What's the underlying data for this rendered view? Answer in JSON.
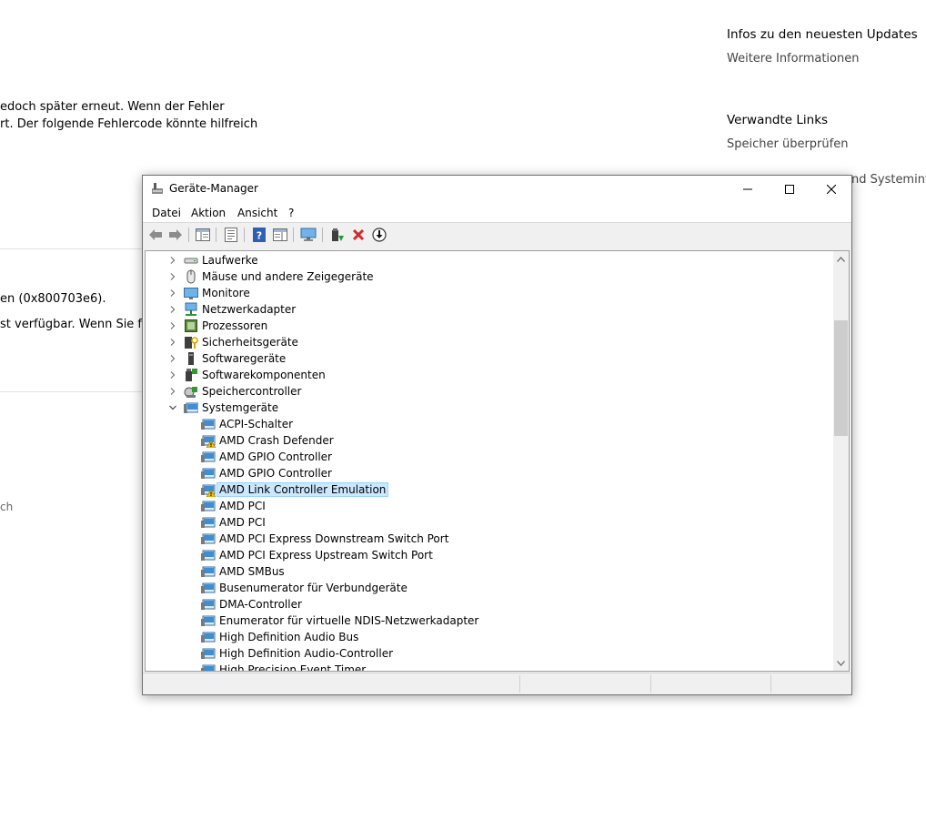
{
  "background": {
    "right_heading_1": "Infos zu den neuesten Updates",
    "right_link_1": "Weitere Informationen",
    "right_heading_2": "Verwandte Links",
    "right_link_2": "Speicher überprüfen",
    "right_link_3_partial": "nd Systeminfo",
    "left_text_1": "edoch später erneut. Wenn der Fehler",
    "left_text_2": "rt. Der folgende Fehlercode könnte hilfreich",
    "left_text_3": "en (0x800703e6).",
    "left_text_4": "st verfügbar. Wenn Sie für",
    "left_text_5": "ch"
  },
  "window": {
    "title": "Geräte-Manager",
    "menu": [
      "Datei",
      "Aktion",
      "Ansicht",
      "?"
    ],
    "toolbar": [
      "back-icon",
      "forward-icon",
      "show-hide-console-tree-icon",
      "properties-icon",
      "help-icon",
      "action-pane-icon",
      "monitor-scan-icon",
      "update-driver-icon",
      "uninstall-icon",
      "download-icon"
    ],
    "tree": [
      {
        "label": "Laufwerke",
        "level": 0,
        "expanded": false,
        "icon": "drive-icon"
      },
      {
        "label": "Mäuse und andere Zeigegeräte",
        "level": 0,
        "expanded": false,
        "icon": "mouse-icon"
      },
      {
        "label": "Monitore",
        "level": 0,
        "expanded": false,
        "icon": "monitor-icon"
      },
      {
        "label": "Netzwerkadapter",
        "level": 0,
        "expanded": false,
        "icon": "network-adapter-icon"
      },
      {
        "label": "Prozessoren",
        "level": 0,
        "expanded": false,
        "icon": "processor-icon"
      },
      {
        "label": "Sicherheitsgeräte",
        "level": 0,
        "expanded": false,
        "icon": "security-device-icon"
      },
      {
        "label": "Softwaregeräte",
        "level": 0,
        "expanded": false,
        "icon": "software-device-icon"
      },
      {
        "label": "Softwarekomponenten",
        "level": 0,
        "expanded": false,
        "icon": "software-component-icon"
      },
      {
        "label": "Speichercontroller",
        "level": 0,
        "expanded": false,
        "icon": "storage-controller-icon"
      },
      {
        "label": "Systemgeräte",
        "level": 0,
        "expanded": true,
        "icon": "system-device-folder-icon"
      },
      {
        "label": "ACPI-Schalter",
        "level": 1,
        "icon": "system-device-icon"
      },
      {
        "label": "AMD Crash Defender",
        "level": 1,
        "icon": "system-device-warning-icon"
      },
      {
        "label": "AMD GPIO Controller",
        "level": 1,
        "icon": "system-device-icon"
      },
      {
        "label": "AMD GPIO Controller",
        "level": 1,
        "icon": "system-device-icon"
      },
      {
        "label": "AMD Link Controller Emulation",
        "level": 1,
        "icon": "system-device-warning-icon",
        "selected": true
      },
      {
        "label": "AMD PCI",
        "level": 1,
        "icon": "system-device-icon"
      },
      {
        "label": "AMD PCI",
        "level": 1,
        "icon": "system-device-icon"
      },
      {
        "label": "AMD PCI Express Downstream Switch Port",
        "level": 1,
        "icon": "system-device-icon"
      },
      {
        "label": "AMD PCI Express Upstream Switch Port",
        "level": 1,
        "icon": "system-device-icon"
      },
      {
        "label": "AMD SMBus",
        "level": 1,
        "icon": "system-device-icon"
      },
      {
        "label": "Busenumerator für Verbundgeräte",
        "level": 1,
        "icon": "system-device-icon"
      },
      {
        "label": "DMA-Controller",
        "level": 1,
        "icon": "system-device-icon"
      },
      {
        "label": "Enumerator für virtuelle NDIS-Netzwerkadapter",
        "level": 1,
        "icon": "system-device-icon"
      },
      {
        "label": "High Definition Audio Bus",
        "level": 1,
        "icon": "system-device-icon"
      },
      {
        "label": "High Definition Audio-Controller",
        "level": 1,
        "icon": "system-device-icon"
      },
      {
        "label": "High Precision Event Timer",
        "level": 1,
        "icon": "system-device-icon"
      }
    ]
  },
  "colors": {
    "selection": "#cce8ff",
    "selection_border": "#99d1ff",
    "device_blue": "#3c8fd6",
    "warning": "#f4c20d",
    "uninstall_red": "#d22a2a"
  }
}
